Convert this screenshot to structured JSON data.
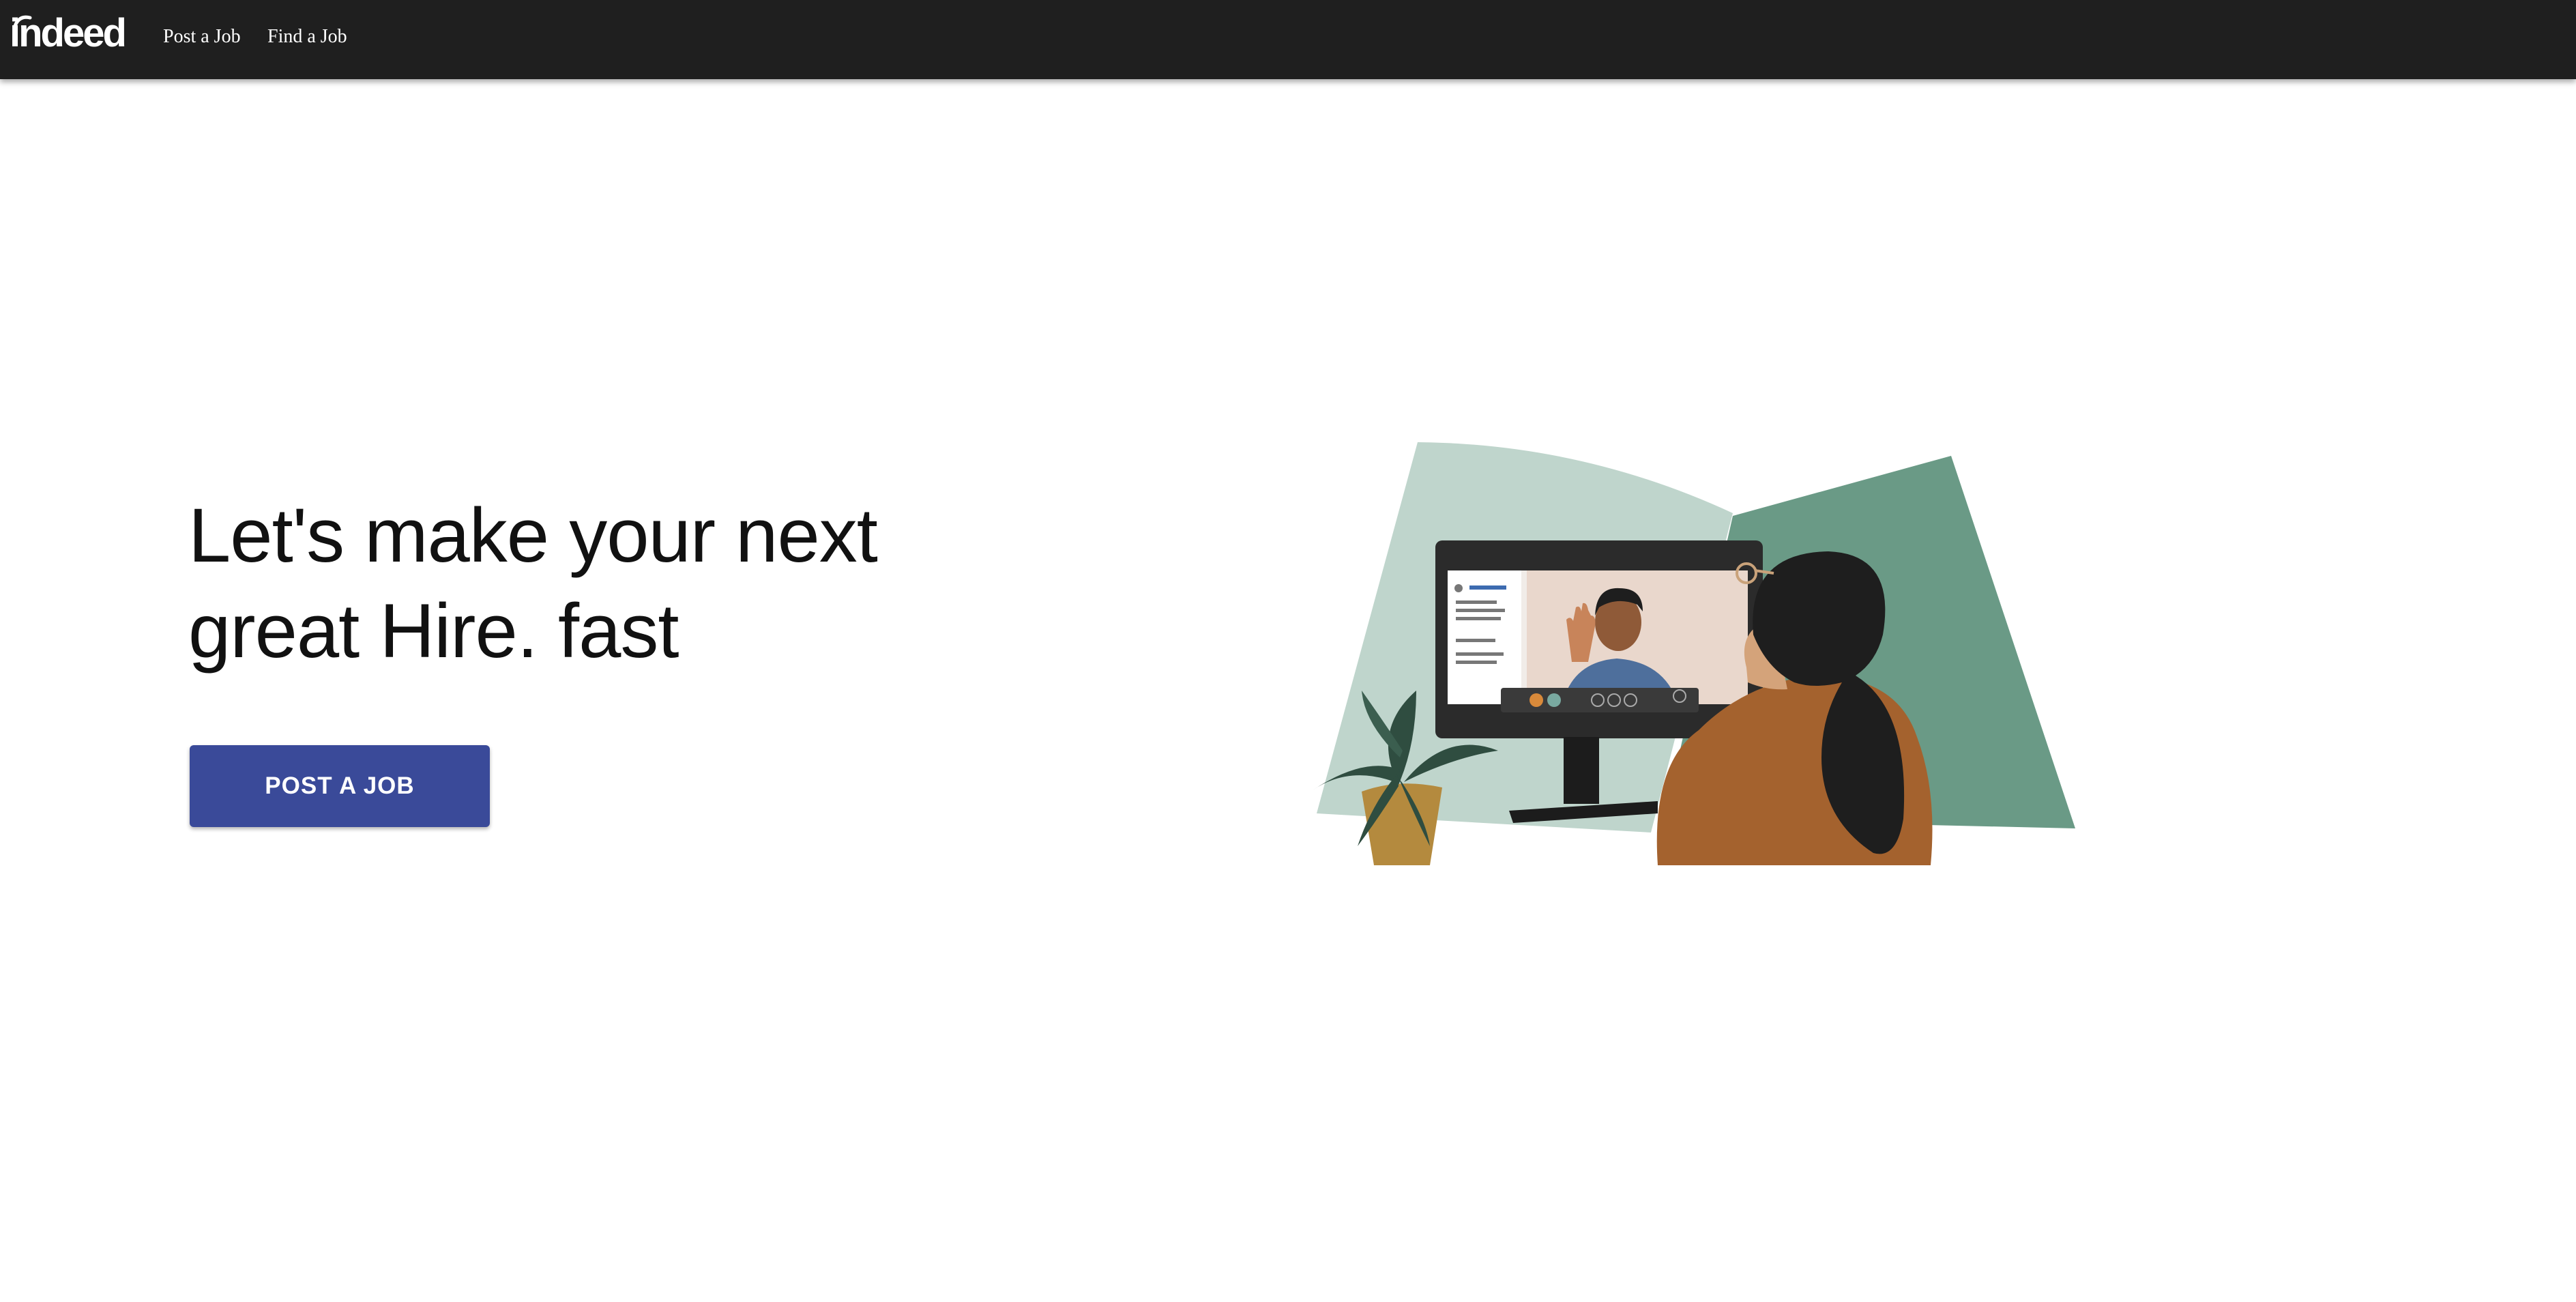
{
  "navbar": {
    "logo_text": "indeed",
    "links": [
      {
        "label": "Post a Job"
      },
      {
        "label": "Find a Job"
      }
    ],
    "background": "#1f1f1f"
  },
  "hero": {
    "headline": "Let's make your next great Hire. fast",
    "cta_label": "POST A JOB",
    "cta_color": "#3a4a99"
  },
  "illustration": {
    "icon": "video-interview-illustration",
    "colors": {
      "bg_light": "#bfd5cc",
      "bg_dark": "#6a9a86",
      "jacket": "#a4622e",
      "hair": "#1e1e1e",
      "plant": "#2f4d40",
      "pot": "#b48a3e"
    }
  }
}
